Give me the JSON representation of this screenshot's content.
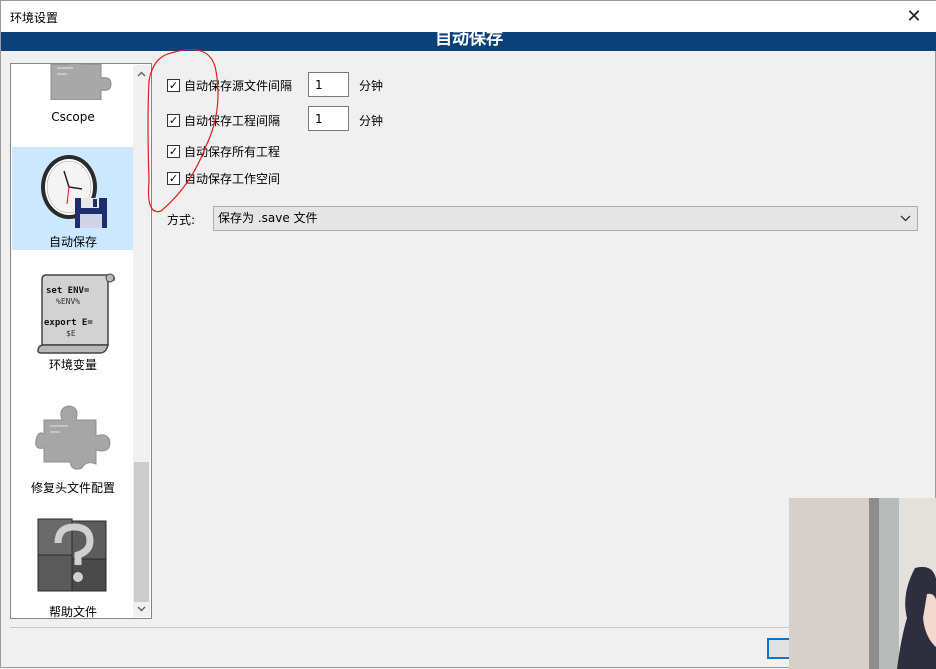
{
  "window": {
    "title": "环境设置",
    "close_glyph": "✕"
  },
  "banner": {
    "title": "自动保存"
  },
  "sidebar": {
    "items": [
      {
        "label": "Cscope",
        "icon": "puzzle-icon"
      },
      {
        "label": "自动保存",
        "icon": "clock-save-icon",
        "selected": true
      },
      {
        "label": "环境变量",
        "icon": "scroll-env-icon"
      },
      {
        "label": "修复头文件配置",
        "icon": "puzzle-icon"
      },
      {
        "label": "帮助文件",
        "icon": "help-question-icon"
      }
    ],
    "env_icon_text": [
      "set ENV=",
      "%ENV%",
      "export E=",
      "$E"
    ]
  },
  "settings": {
    "autosave_source": {
      "label": "自动保存源文件间隔",
      "checked": true,
      "value": "1",
      "unit": "分钟"
    },
    "autosave_project": {
      "label": "自动保存工程间隔",
      "checked": true,
      "value": "1",
      "unit": "分钟"
    },
    "autosave_all_projects": {
      "label": "自动保存所有工程",
      "checked": true
    },
    "autosave_workspace": {
      "label": "自动保存工作空间",
      "checked": true
    },
    "mode": {
      "label": "方式:",
      "value": "保存为 .save 文件"
    }
  },
  "colors": {
    "banner": "#0b4179",
    "selected": "#cce8ff",
    "annotation": "#e02020"
  }
}
